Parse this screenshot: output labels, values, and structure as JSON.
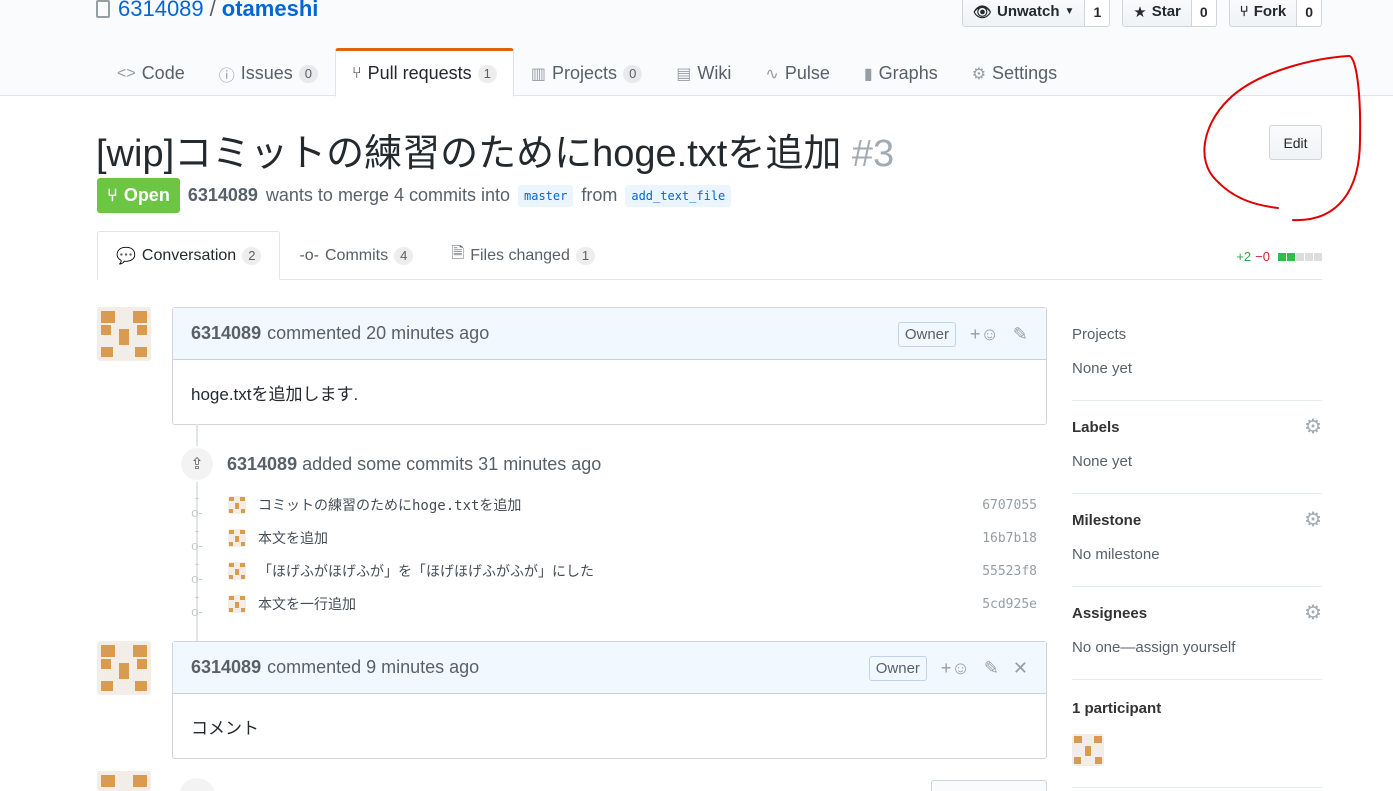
{
  "repo": {
    "owner": "6314089",
    "separator": "/",
    "name": "otameshi"
  },
  "actions": {
    "watch": {
      "label": "Unwatch",
      "count": "1"
    },
    "star": {
      "label": "Star",
      "count": "0"
    },
    "fork": {
      "label": "Fork",
      "count": "0"
    }
  },
  "nav": [
    {
      "label": "Code",
      "icon": "code-icon"
    },
    {
      "label": "Issues",
      "count": "0",
      "icon": "issue-icon"
    },
    {
      "label": "Pull requests",
      "count": "1",
      "icon": "pull-request-icon",
      "selected": true
    },
    {
      "label": "Projects",
      "count": "0",
      "icon": "project-icon"
    },
    {
      "label": "Wiki",
      "icon": "book-icon"
    },
    {
      "label": "Pulse",
      "icon": "pulse-icon"
    },
    {
      "label": "Graphs",
      "icon": "graph-icon"
    },
    {
      "label": "Settings",
      "icon": "gear-icon"
    }
  ],
  "pr": {
    "title": "[wip]コミットの練習のためにhoge.txtを追加",
    "number": "#3",
    "edit_label": "Edit",
    "state": "Open",
    "author": "6314089",
    "merge_text": "wants to merge 4 commits into",
    "base": "master",
    "from_text": "from",
    "head": "add_text_file"
  },
  "tabs": [
    {
      "label": "Conversation",
      "count": "2",
      "selected": true
    },
    {
      "label": "Commits",
      "count": "4"
    },
    {
      "label": "Files changed",
      "count": "1"
    }
  ],
  "diffstat": {
    "additions": "+2",
    "deletions": "−0"
  },
  "comments": [
    {
      "author": "6314089",
      "text": "commented 20 minutes ago",
      "role": "Owner",
      "body": "hoge.txtを追加します."
    },
    {
      "author": "6314089",
      "text": "commented 9 minutes ago",
      "role": "Owner",
      "body": "コメント"
    }
  ],
  "commits_event": {
    "author": "6314089",
    "text": "added some commits 31 minutes ago",
    "commits": [
      {
        "message": "コミットの練習のためにhoge.txtを追加",
        "sha": "6707055"
      },
      {
        "message": "本文を追加",
        "sha": "16b7b18"
      },
      {
        "message": "「ほげふがほげふが」を「ほげほげふがふが」にした",
        "sha": "55523f8"
      },
      {
        "message": "本文を一行追加",
        "sha": "5cd925e"
      }
    ]
  },
  "sidebar": {
    "projects": {
      "title": "Projects",
      "value": "None yet"
    },
    "labels": {
      "title": "Labels",
      "value": "None yet"
    },
    "milestone": {
      "title": "Milestone",
      "value": "No milestone"
    },
    "assignees": {
      "title": "Assignees",
      "value": "No one—assign yourself"
    },
    "participants": {
      "title": "1 participant"
    }
  },
  "colors": {
    "open": "#6cc644",
    "link": "#0366d6",
    "accent": "#e36209",
    "annotation": "#e00000"
  }
}
